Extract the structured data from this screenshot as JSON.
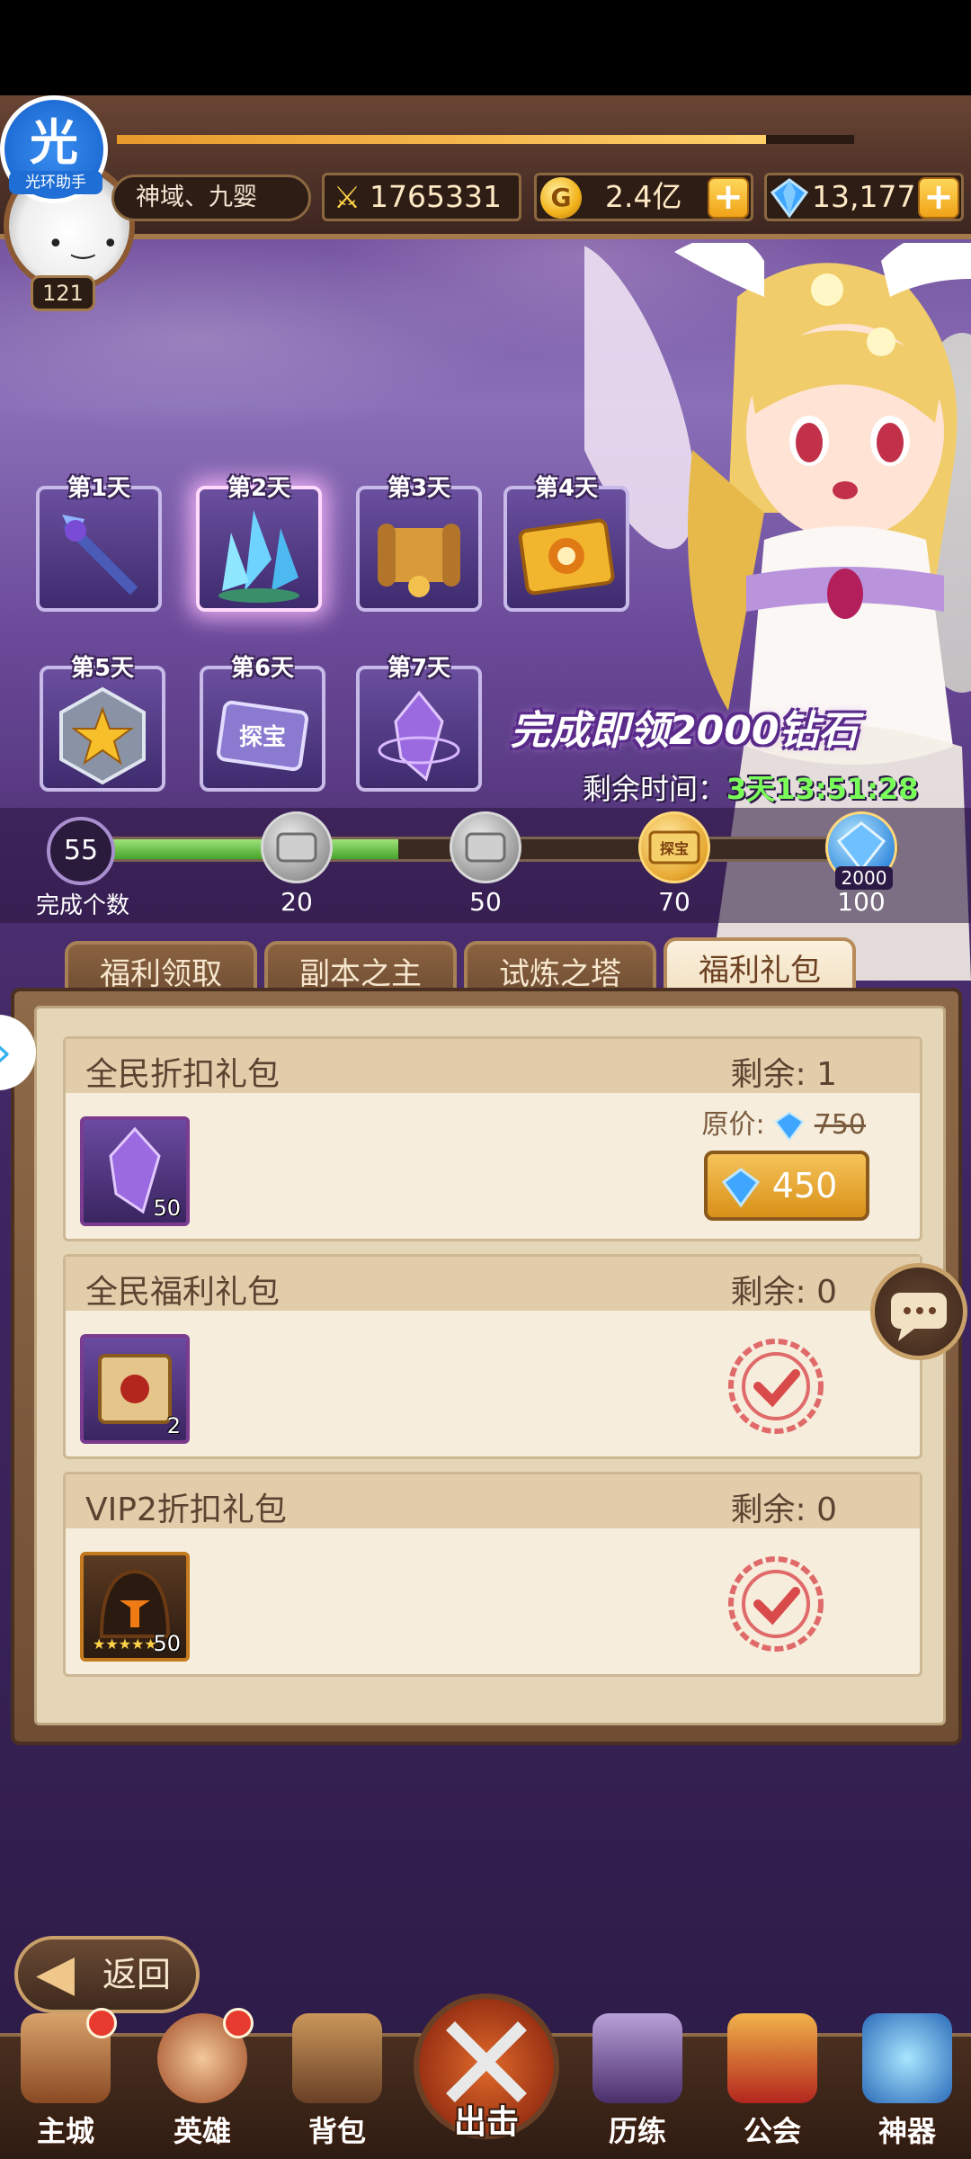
{
  "helper": {
    "badge": "光",
    "label": "光环助手"
  },
  "player": {
    "level": "121",
    "server": "神域、九婴",
    "power": "1765331",
    "gold": "2.4亿",
    "gems": "13,177",
    "gold_icon_letter": "G",
    "exp_progress": 0.88
  },
  "days": [
    {
      "label": "第1天",
      "icon": "scepter-icon"
    },
    {
      "label": "第2天",
      "icon": "crystal-cluster-icon"
    },
    {
      "label": "第3天",
      "icon": "scroll-icon"
    },
    {
      "label": "第4天",
      "icon": "ticket-icon"
    },
    {
      "label": "第5天",
      "icon": "star-medal-icon"
    },
    {
      "label": "第6天",
      "icon": "treasure-card-icon"
    },
    {
      "label": "第7天",
      "icon": "purple-crystal-icon"
    }
  ],
  "day6_card_text": "探宝",
  "promo": {
    "text": "完成即领2000钻石"
  },
  "remaining": {
    "label": "剩余时间：",
    "time": "3天13:51:28"
  },
  "progress": {
    "count": "55",
    "caption": "完成个数",
    "fraction": 0.39,
    "milestones": [
      "20",
      "50",
      "70",
      "100"
    ],
    "milestone_badge": "2000",
    "treasure_text": "探宝"
  },
  "tabs": [
    "福利领取",
    "副本之主",
    "试炼之塔",
    "福利礼包"
  ],
  "packs": [
    {
      "name": "全民折扣礼包",
      "stock": "剩余: 1",
      "item_count": "50",
      "orig_label": "原价:",
      "orig_price": "750",
      "price": "450"
    },
    {
      "name": "全民福利礼包",
      "stock": "剩余: 0",
      "item_count": "2"
    },
    {
      "name": "VIP2折扣礼包",
      "stock": "剩余: 0",
      "item_count": "50"
    }
  ],
  "back_label": "返回",
  "nav": [
    "主城",
    "英雄",
    "背包",
    "出击",
    "历练",
    "公会",
    "神器"
  ],
  "colors": {
    "accent_green": "#7aff5a",
    "panel_bg": "#e6d6b8",
    "red_dot": "#e63b2e"
  }
}
